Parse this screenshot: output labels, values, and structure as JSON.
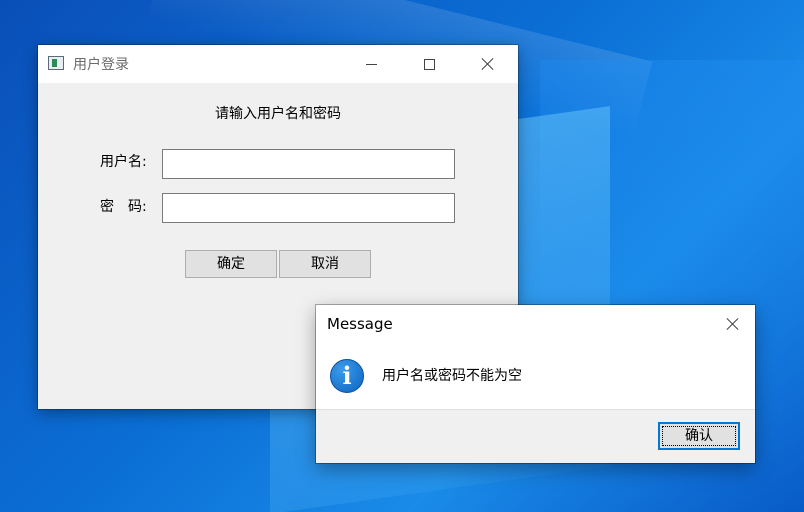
{
  "login_window": {
    "title": "用户登录",
    "prompt": "请输入用户名和密码",
    "username_label": "用户名:",
    "password_label": "密　码:",
    "username_value": "",
    "password_value": "",
    "ok_label": "确定",
    "cancel_label": "取消"
  },
  "message_box": {
    "title": "Message",
    "text": "用户名或密码不能为空",
    "icon": "info-icon",
    "icon_glyph": "i",
    "ok_label": "确认"
  },
  "colors": {
    "accent": "#0078d7",
    "window_bg": "#f0f0f0",
    "desktop": "#0b6fd6"
  }
}
